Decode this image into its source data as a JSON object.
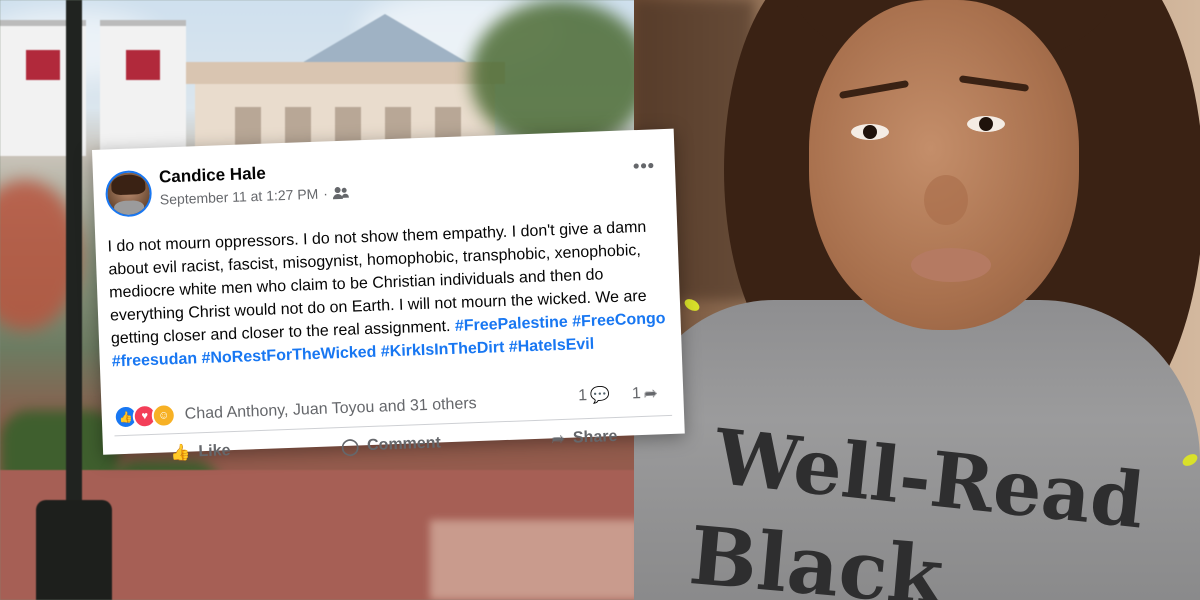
{
  "post": {
    "author": "Candice Hale",
    "timestamp": "September 11 at 1:27 PM",
    "meta_separator": "·",
    "audience_icon": "friends-icon",
    "more_label": "•••",
    "text": "I do not mourn oppressors. I do not show them empathy. I don't give a damn about evil racist, fascist, misogynist, homophobic, transphobic, xenophobic, mediocre white men who claim to be Christian individuals and then do everything Christ would not do on Earth. I will not mourn the wicked. We are getting closer and closer to the real assignment.",
    "hashtags": "#FreePalestine #FreeCongo #freesudan #NoRestForTheWicked #KirkIsInTheDirt #HateIsEvil",
    "reactions_summary": "Chad Anthony, Juan Toyou and 31 others",
    "reaction_icons": [
      "like-reaction-icon",
      "love-reaction-icon",
      "care-reaction-icon"
    ],
    "comment_count": "1",
    "share_count": "1",
    "actions": {
      "like": "Like",
      "comment": "Comment",
      "share": "Share"
    }
  },
  "photo": {
    "shirt_line1": "Well-Read",
    "shirt_line2": "Black"
  },
  "colors": {
    "facebook_blue": "#1877f2",
    "secondary_text": "#65676b",
    "love_red": "#f33e58",
    "care_yellow": "#f7b125"
  }
}
